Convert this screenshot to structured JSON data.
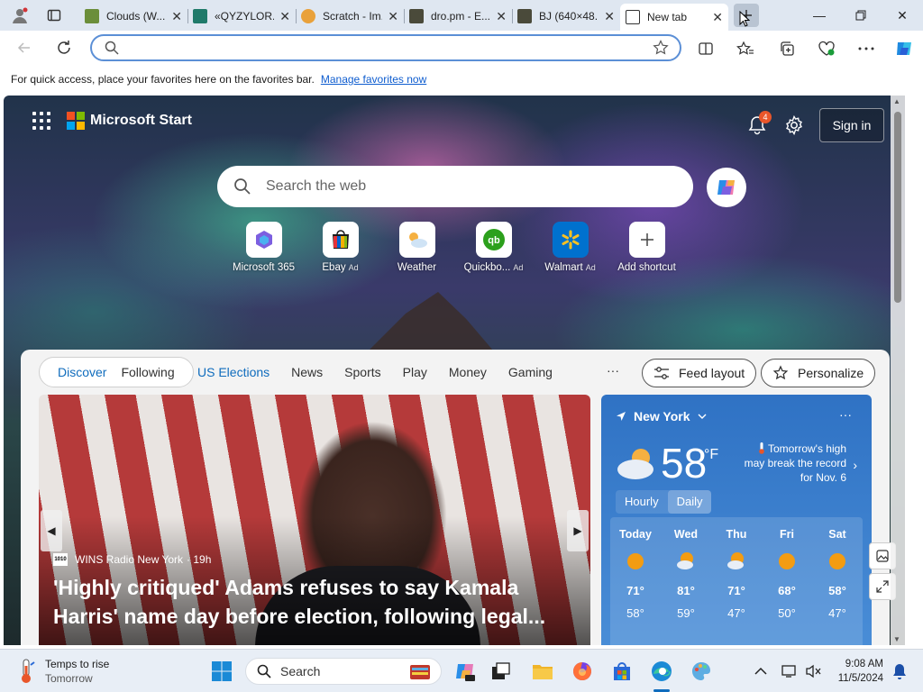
{
  "tabs": [
    {
      "label": "Clouds (W...",
      "favicon_color": "#6b8e3a"
    },
    {
      "label": "«QYZYLOR...",
      "favicon_color": "#1f7a6a"
    },
    {
      "label": "Scratch - Im...",
      "favicon_color": "#e9a13a"
    },
    {
      "label": "dro.pm - E...",
      "favicon_color": "#4a4a3a"
    },
    {
      "label": "BJ (640×48...",
      "favicon_color": "#4a4a3a"
    },
    {
      "label": "New tab",
      "favicon_color": "#ffffff",
      "active": true
    }
  ],
  "address": {
    "value": "",
    "placeholder": ""
  },
  "favorites_bar": {
    "text": "For quick access, place your favorites here on the favorites bar.",
    "link": "Manage favorites now"
  },
  "start": {
    "brand": "Microsoft Start",
    "notifications": "4",
    "signin": "Sign in",
    "search_placeholder": "Search the web"
  },
  "shortcuts": [
    {
      "label": "Microsoft 365",
      "ad": "",
      "icon": "m365-icon"
    },
    {
      "label": "Ebay",
      "ad": "Ad",
      "icon": "ebay-icon"
    },
    {
      "label": "Weather",
      "ad": "",
      "icon": "weather-icon"
    },
    {
      "label": "Quickbo...",
      "ad": "Ad",
      "icon": "quickbooks-icon"
    },
    {
      "label": "Walmart",
      "ad": "Ad",
      "icon": "walmart-icon"
    },
    {
      "label": "Add shortcut",
      "ad": "",
      "icon": "add-icon"
    }
  ],
  "feed": {
    "pill": [
      "Discover",
      "Following"
    ],
    "tabs": [
      "US Elections",
      "News",
      "Sports",
      "Play",
      "Money",
      "Gaming"
    ],
    "more": "···",
    "layout_btn": "Feed layout",
    "personalize_btn": "Personalize"
  },
  "hero": {
    "source": "WINS Radio New York",
    "source_logo": "1010",
    "age": "· 19h",
    "title": "'Highly critiqued' Adams refuses to say Kamala Harris' name day before election, following legal..."
  },
  "weather": {
    "location": "New York",
    "temp": "58",
    "unit": "°F",
    "note": "Tomorrow's high may break the record for Nov. 6",
    "toggle": [
      "Hourly",
      "Daily"
    ],
    "days": [
      {
        "name": "Today",
        "hi": "71°",
        "lo": "58°",
        "icon": "sun"
      },
      {
        "name": "Wed",
        "hi": "81°",
        "lo": "59°",
        "icon": "partly-cloudy"
      },
      {
        "name": "Thu",
        "hi": "71°",
        "lo": "47°",
        "icon": "partly-cloudy"
      },
      {
        "name": "Fri",
        "hi": "68°",
        "lo": "50°",
        "icon": "sun"
      },
      {
        "name": "Sat",
        "hi": "58°",
        "lo": "47°",
        "icon": "sun"
      }
    ]
  },
  "taskbar": {
    "weather_title": "Temps to rise",
    "weather_sub": "Tomorrow",
    "search": "Search",
    "time": "9:08 AM",
    "date": "11/5/2024"
  }
}
